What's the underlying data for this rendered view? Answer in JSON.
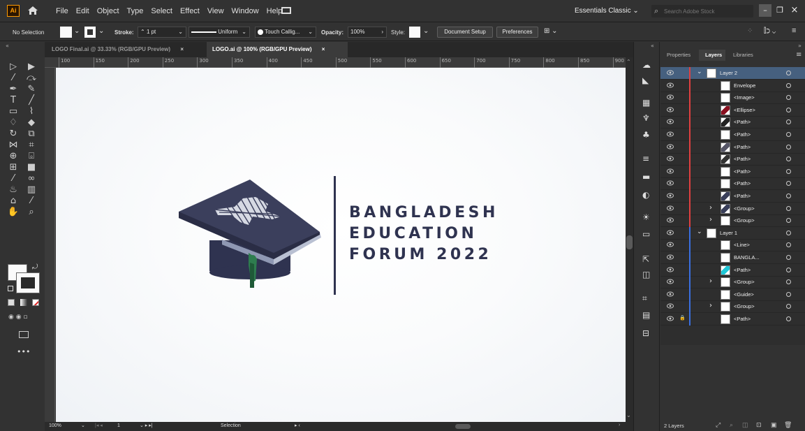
{
  "app": {
    "logo": "Ai",
    "workspace": "Essentials Classic",
    "search_placeholder": "Search Adobe Stock"
  },
  "menu": [
    "File",
    "Edit",
    "Object",
    "Type",
    "Select",
    "Effect",
    "View",
    "Window",
    "Help"
  ],
  "control": {
    "selection": "No Selection",
    "stroke_label": "Stroke:",
    "stroke_value": "1 pt",
    "stroke_profile": "Uniform",
    "brush": "Touch Callig...",
    "opacity_label": "Opacity:",
    "opacity_value": "100%",
    "style_label": "Style:",
    "doc_setup": "Document Setup",
    "preferences": "Preferences"
  },
  "tabs": [
    {
      "label": "LOGO Final.ai @ 33.33% (RGB/GPU Preview)",
      "close": "×"
    },
    {
      "label": "LOGO.ai @ 100% (RGB/GPU Preview)",
      "close": "×"
    }
  ],
  "ruler_h": [
    "100",
    "150",
    "200",
    "250",
    "300",
    "350",
    "400",
    "450",
    "500",
    "550",
    "600",
    "650",
    "700",
    "750",
    "800",
    "850",
    "900"
  ],
  "logo": {
    "line1": "BANGLADESH",
    "line2": "EDUCATION",
    "line3": "FORUM 2022"
  },
  "status": {
    "zoom": "100%",
    "page": "1",
    "tool": "Selection"
  },
  "panel": {
    "tabs": [
      "Properties",
      "Layers",
      "Libraries"
    ],
    "footer_count": "2 Layers"
  },
  "layers": [
    {
      "name": "Layer 2",
      "indent": 0,
      "kind": "layer",
      "expanded": true,
      "color": "#e04040",
      "selected": true
    },
    {
      "name": "Envelope",
      "indent": 2,
      "color": "#e04040"
    },
    {
      "name": "<Image>",
      "indent": 2,
      "color": "#e04040"
    },
    {
      "name": "<Ellipse>",
      "indent": 2,
      "color": "#e04040",
      "thumb": "#8a1020"
    },
    {
      "name": "<Path>",
      "indent": 2,
      "color": "#e04040",
      "thumb": "#222"
    },
    {
      "name": "<Path>",
      "indent": 2,
      "color": "#e04040"
    },
    {
      "name": "<Path>",
      "indent": 2,
      "color": "#e04040",
      "thumb": "#556"
    },
    {
      "name": "<Path>",
      "indent": 2,
      "color": "#e04040",
      "thumb": "#333"
    },
    {
      "name": "<Path>",
      "indent": 2,
      "color": "#e04040"
    },
    {
      "name": "<Path>",
      "indent": 2,
      "color": "#e04040"
    },
    {
      "name": "<Path>",
      "indent": 2,
      "color": "#e04040",
      "thumb": "#3a3f5a"
    },
    {
      "name": "<Group>",
      "indent": 1,
      "kind": "group",
      "color": "#e04040",
      "thumb": "#3a3f5a"
    },
    {
      "name": "<Group>",
      "indent": 1,
      "kind": "group",
      "color": "#e04040"
    },
    {
      "name": "Layer 1",
      "indent": 0,
      "kind": "layer",
      "expanded": true,
      "color": "#3a6fe0"
    },
    {
      "name": "<Line>",
      "indent": 2,
      "color": "#3a6fe0"
    },
    {
      "name": "BANGLA...",
      "indent": 2,
      "color": "#3a6fe0"
    },
    {
      "name": "<Path>",
      "indent": 2,
      "color": "#3a6fe0",
      "thumb": "#1ec6d6"
    },
    {
      "name": "<Group>",
      "indent": 1,
      "kind": "group",
      "color": "#3a6fe0"
    },
    {
      "name": "<Guide>",
      "indent": 2,
      "color": "#3a6fe0"
    },
    {
      "name": "<Group>",
      "indent": 1,
      "kind": "group",
      "color": "#3a6fe0"
    },
    {
      "name": "<Path>",
      "indent": 2,
      "color": "#3a6fe0",
      "locked": true
    }
  ]
}
